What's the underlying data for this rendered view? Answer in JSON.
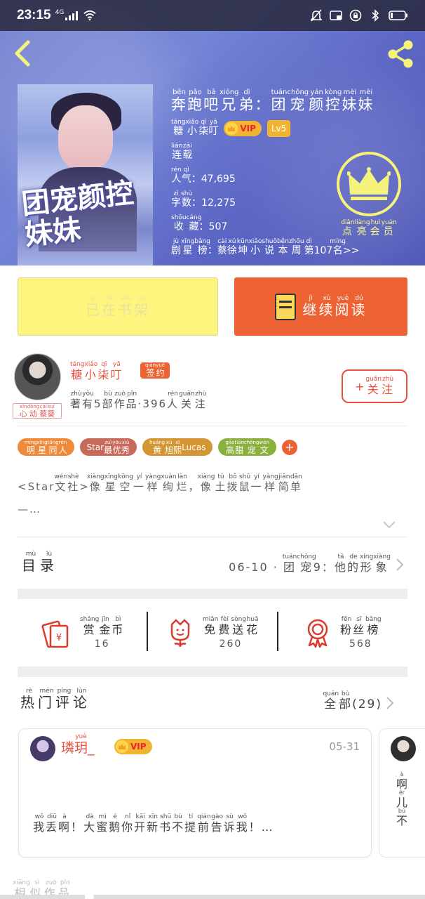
{
  "status_bar": {
    "time": "23:15",
    "network": "4G"
  },
  "book": {
    "title_part1": [
      [
        "奔",
        "bēn"
      ],
      [
        "跑",
        "pǎo"
      ],
      [
        "吧",
        "bā"
      ],
      [
        "兄",
        "xiōng"
      ],
      [
        "弟",
        "dì"
      ]
    ],
    "title_sep": "：",
    "title_part2": [
      [
        "团",
        "tuán"
      ],
      [
        "宠",
        "chǒng"
      ],
      [
        "颜",
        "yán"
      ],
      [
        "控",
        "kòng"
      ],
      [
        "妹",
        "mèi"
      ],
      [
        "妹",
        "mèi"
      ]
    ],
    "author_name": [
      [
        "糖",
        "táng"
      ],
      [
        "小",
        "xiǎo"
      ],
      [
        "柒",
        "qī"
      ],
      [
        "叮",
        "yǎ"
      ]
    ],
    "vip_label": "VIP",
    "level": "Lv5",
    "status": [
      [
        "连",
        "lián"
      ],
      [
        "载",
        "zǎi"
      ]
    ],
    "popularity_label": [
      [
        "人",
        "rén"
      ],
      [
        "气",
        "qì"
      ]
    ],
    "popularity_value": "47,695",
    "word_count_label": [
      [
        "字",
        "zì"
      ],
      [
        "数",
        "shù"
      ]
    ],
    "word_count_value": "12,275",
    "favorites_label": [
      [
        "收",
        "shōu"
      ],
      [
        "藏",
        "cáng"
      ]
    ],
    "favorites_value": "507",
    "rank_label": [
      [
        "剧",
        "jù"
      ],
      [
        "星",
        "xīng"
      ],
      [
        "榜",
        "bǎng"
      ]
    ],
    "rank_text": [
      [
        "蔡",
        "cài"
      ],
      [
        "徐",
        "xú"
      ],
      [
        "坤",
        "kūn"
      ],
      [
        "小",
        "xiǎo"
      ],
      [
        "说",
        "shuō"
      ],
      [
        "本",
        "běn"
      ],
      [
        "周",
        "zhōu"
      ],
      [
        "第",
        "dì"
      ]
    ],
    "rank_number": "107",
    "rank_suffix": [
      [
        "名",
        "míng"
      ]
    ],
    "rank_arrow": ">>",
    "cover_title": "团宠颜控妹妹",
    "member_label": [
      [
        "点",
        "diǎn"
      ],
      [
        "亮",
        "liàng"
      ],
      [
        "会",
        "huì"
      ],
      [
        "员",
        "yuán"
      ]
    ]
  },
  "actions": {
    "shelf_label": [
      [
        "已",
        "yǐ"
      ],
      [
        "在",
        "zài"
      ],
      [
        "书",
        "shū"
      ],
      [
        "架",
        "jià"
      ]
    ],
    "read_label": [
      [
        "继",
        "jì"
      ],
      [
        "续",
        "xù"
      ],
      [
        "阅",
        "yuè"
      ],
      [
        "读",
        "dú"
      ]
    ]
  },
  "author": {
    "name": [
      [
        "糖",
        "táng"
      ],
      [
        "小",
        "xiǎo"
      ],
      [
        "柒",
        "qī"
      ],
      [
        "叮",
        "yǎ"
      ]
    ],
    "sign_badge": [
      [
        "签",
        "qiān"
      ],
      [
        "约",
        "yuē"
      ]
    ],
    "avatar_tag": [
      [
        "心",
        "xīn"
      ],
      [
        "动",
        "dòng"
      ],
      [
        "蔡",
        "cài"
      ],
      [
        "葵",
        "kuí"
      ]
    ],
    "stats_pre": [
      [
        "著",
        "zhù"
      ],
      [
        "有",
        "yǒu"
      ]
    ],
    "works_count": "5",
    "stats_mid": [
      [
        "部",
        "bù"
      ],
      [
        "作",
        "zuò"
      ],
      [
        "品",
        "pǐn"
      ]
    ],
    "stats_dot": "·",
    "fans_count": "396",
    "stats_post": [
      [
        "人",
        "rén"
      ],
      [
        "关",
        "guān"
      ],
      [
        "注",
        "zhù"
      ]
    ],
    "follow_plus": "+",
    "follow_label": [
      [
        "关",
        "guān"
      ],
      [
        "注",
        "zhù"
      ]
    ]
  },
  "tags": [
    {
      "label": [
        [
          "明",
          "míng"
        ],
        [
          "星",
          "xīng"
        ],
        [
          "同",
          "tóng"
        ],
        [
          "人",
          "rén"
        ]
      ],
      "color": "#ee8a3a"
    },
    {
      "label_prefix": "Star",
      "label": [
        [
          "最",
          "zuì"
        ],
        [
          "优",
          "yōu"
        ],
        [
          "秀",
          "xiù"
        ]
      ],
      "color": "#c86a5a"
    },
    {
      "label": [
        [
          "黄",
          "huáng"
        ],
        [
          "旭",
          "xù"
        ],
        [
          "熙",
          "xī"
        ]
      ],
      "label_suffix": "Lucas",
      "color": "#d49634"
    },
    {
      "label": [
        [
          "高",
          "gāo"
        ],
        [
          "甜",
          "tián"
        ],
        [
          "宠",
          "chǒng"
        ],
        [
          "文",
          "wén"
        ]
      ],
      "color": "#8ab03e"
    }
  ],
  "tag_add": "+",
  "description": {
    "prefix": "<Star",
    "part1": [
      [
        "文",
        "wén"
      ],
      [
        "社",
        "shè"
      ]
    ],
    "gt": ">",
    "part2": [
      [
        "像",
        "xiàng"
      ],
      [
        "星",
        "xīng"
      ],
      [
        "空",
        "kōng"
      ],
      [
        "一",
        "yí"
      ],
      [
        "样",
        "yàng"
      ],
      [
        "绚",
        "xuàn"
      ],
      [
        "烂",
        "làn"
      ]
    ],
    "comma": "，",
    "part3": [
      [
        "像",
        "xiàng"
      ],
      [
        "土",
        "tǔ"
      ],
      [
        "拨",
        "bō"
      ],
      [
        "鼠",
        "shǔ"
      ],
      [
        "一",
        "yí"
      ],
      [
        "样",
        "yàng"
      ],
      [
        "简",
        "jiǎn"
      ],
      [
        "单",
        "dān"
      ]
    ],
    "ellipsis": "—…"
  },
  "catalog": {
    "label": [
      [
        "目",
        "mù"
      ],
      [
        "录",
        "lù"
      ]
    ],
    "latest_date": "06-10",
    "dot": "·",
    "latest_part1": [
      [
        "团",
        "tuán"
      ],
      [
        "宠",
        "chǒng"
      ]
    ],
    "latest_num": "9",
    "latest_colon": "：",
    "latest_part2": [
      [
        "他",
        "tā"
      ],
      [
        "的",
        "de"
      ],
      [
        "形",
        "xíng"
      ],
      [
        "象",
        "xiàng"
      ]
    ]
  },
  "gifts": [
    {
      "label": [
        [
          "赏",
          "shǎng"
        ],
        [
          "金",
          "jīn"
        ],
        [
          "币",
          "bì"
        ]
      ],
      "value": "16",
      "icon": "red-envelope-icon"
    },
    {
      "label": [
        [
          "免",
          "miǎn"
        ],
        [
          "费",
          "fèi"
        ],
        [
          "送",
          "sòng"
        ],
        [
          "花",
          "huā"
        ]
      ],
      "value": "260",
      "icon": "flower-icon"
    },
    {
      "label": [
        [
          "粉",
          "fěn"
        ],
        [
          "丝",
          "sī"
        ],
        [
          "榜",
          "bǎng"
        ]
      ],
      "value": "568",
      "icon": "medal-icon"
    }
  ],
  "hot_comments": {
    "label": [
      [
        "热",
        "rè"
      ],
      [
        "门",
        "mén"
      ],
      [
        "评",
        "píng"
      ],
      [
        "论",
        "lùn"
      ]
    ],
    "all_label": [
      [
        "全",
        "quán"
      ],
      [
        "部",
        "bù"
      ]
    ],
    "count": "(29)"
  },
  "comments": [
    {
      "name_char": "璘",
      "name_ruby": [
        [
          "玥",
          "yuè"
        ]
      ],
      "name_suffix": "_",
      "vip": "VIP",
      "date": "05-31",
      "text": [
        [
          "我",
          "wǒ"
        ],
        [
          "丢",
          "diū"
        ],
        [
          "啊",
          "à"
        ]
      ],
      "text_punct": "！",
      "text2": [
        [
          "大",
          "dà"
        ],
        [
          "蜜",
          "mì"
        ],
        [
          "鹅",
          "é"
        ],
        [
          "你",
          "nǐ"
        ],
        [
          "开",
          "kāi"
        ],
        [
          "新",
          "xīn"
        ],
        [
          "书",
          "shū"
        ],
        [
          "不",
          "bù"
        ],
        [
          "提",
          "tí"
        ],
        [
          "前",
          "qián"
        ],
        [
          "告",
          "gào"
        ],
        [
          "诉",
          "sù"
        ],
        [
          "我",
          "wǒ"
        ]
      ],
      "text_end": "！…"
    },
    {
      "text": [
        [
          "啊",
          "à"
        ],
        [
          "儿",
          "ér"
        ],
        [
          "不",
          "bú"
        ]
      ]
    }
  ],
  "similar_label": [
    [
      "相",
      "xiāng"
    ],
    [
      "似",
      "sì"
    ],
    [
      "作",
      "zuò"
    ],
    [
      "品",
      "pǐn"
    ]
  ],
  "colors": {
    "accent": "#ec6233",
    "red_text": "#e94f3d",
    "yellow_btn": "#fdf57e",
    "hero_blue": "#6473cc"
  }
}
